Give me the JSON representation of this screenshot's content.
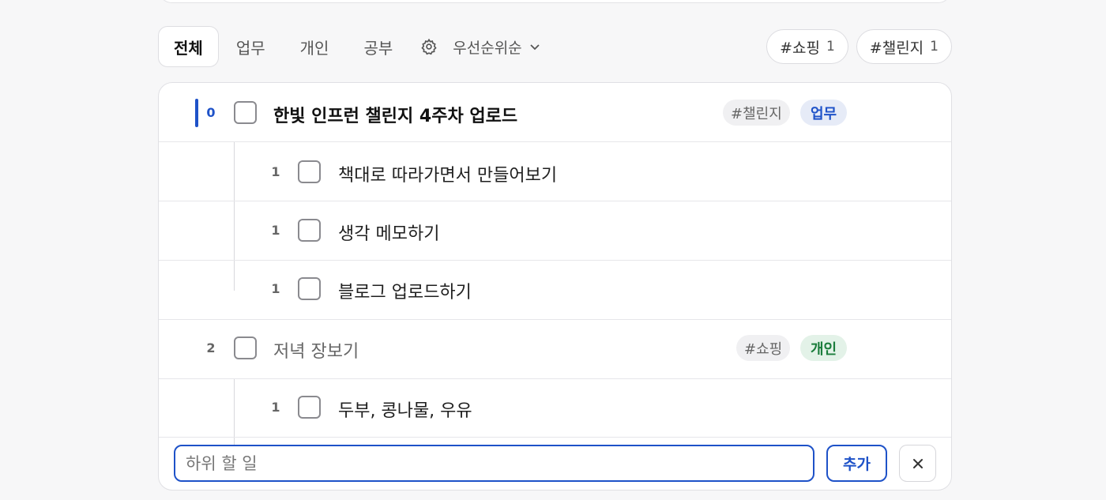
{
  "tabs": [
    {
      "label": "전체",
      "active": true
    },
    {
      "label": "업무",
      "active": false
    },
    {
      "label": "개인",
      "active": false
    },
    {
      "label": "공부",
      "active": false
    }
  ],
  "settings_icon": "gear-icon",
  "sort": {
    "label": "우선순위순",
    "icon": "chevron-down-icon"
  },
  "tag_filters": [
    {
      "label": "#쇼핑",
      "count": "1"
    },
    {
      "label": "#챌린지",
      "count": "1"
    }
  ],
  "tasks": [
    {
      "priority": "0",
      "title": "한빛 인프런 챌린지 4주차 업로드",
      "tag": "#챌린지",
      "category": "업무",
      "subtasks": [
        {
          "priority": "1",
          "title": "책대로 따라가면서 만들어보기"
        },
        {
          "priority": "1",
          "title": "생각 메모하기"
        },
        {
          "priority": "1",
          "title": "블로그 업로드하기"
        }
      ]
    },
    {
      "priority": "2",
      "title": "저녁 장보기",
      "tag": "#쇼핑",
      "category": "개인",
      "subtasks": [
        {
          "priority": "1",
          "title": "두부, 콩나물, 우유"
        }
      ]
    }
  ],
  "subtask_input": {
    "placeholder": "하위 할 일",
    "value": ""
  },
  "add_button": "추가",
  "close_icon": "close-icon",
  "colors": {
    "accent": "#1e52c8",
    "work_bg": "#e6ebf7",
    "personal_bg": "#e3f2e8",
    "personal_text": "#1b7d3c"
  }
}
